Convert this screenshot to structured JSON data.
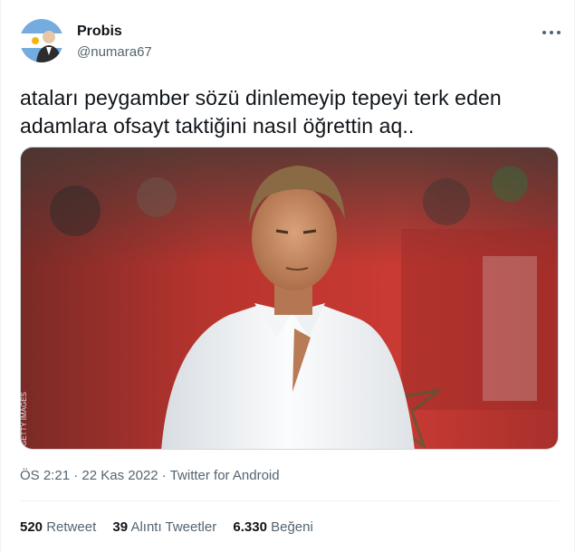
{
  "author": {
    "display_name": "Probis",
    "handle": "@numara67"
  },
  "tweet": {
    "text_line1": "ataları peygamber sözü dinlemeyip tepeyi terk eden",
    "text_line2": "adamlara ofsayt taktiğini nasıl öğrettin aq..",
    "image_credit": "GETTY IMAGES"
  },
  "meta": {
    "time": "ÖS 2:21",
    "separator": " · ",
    "date": "22 Kas 2022",
    "source": "Twitter for Android"
  },
  "stats": {
    "retweets_count": "520",
    "retweets_label": "Retweet",
    "quotes_count": "39",
    "quotes_label": "Alıntı Tweetler",
    "likes_count": "6.330",
    "likes_label": "Beğeni"
  },
  "icons": {
    "more": "more-options-icon"
  }
}
